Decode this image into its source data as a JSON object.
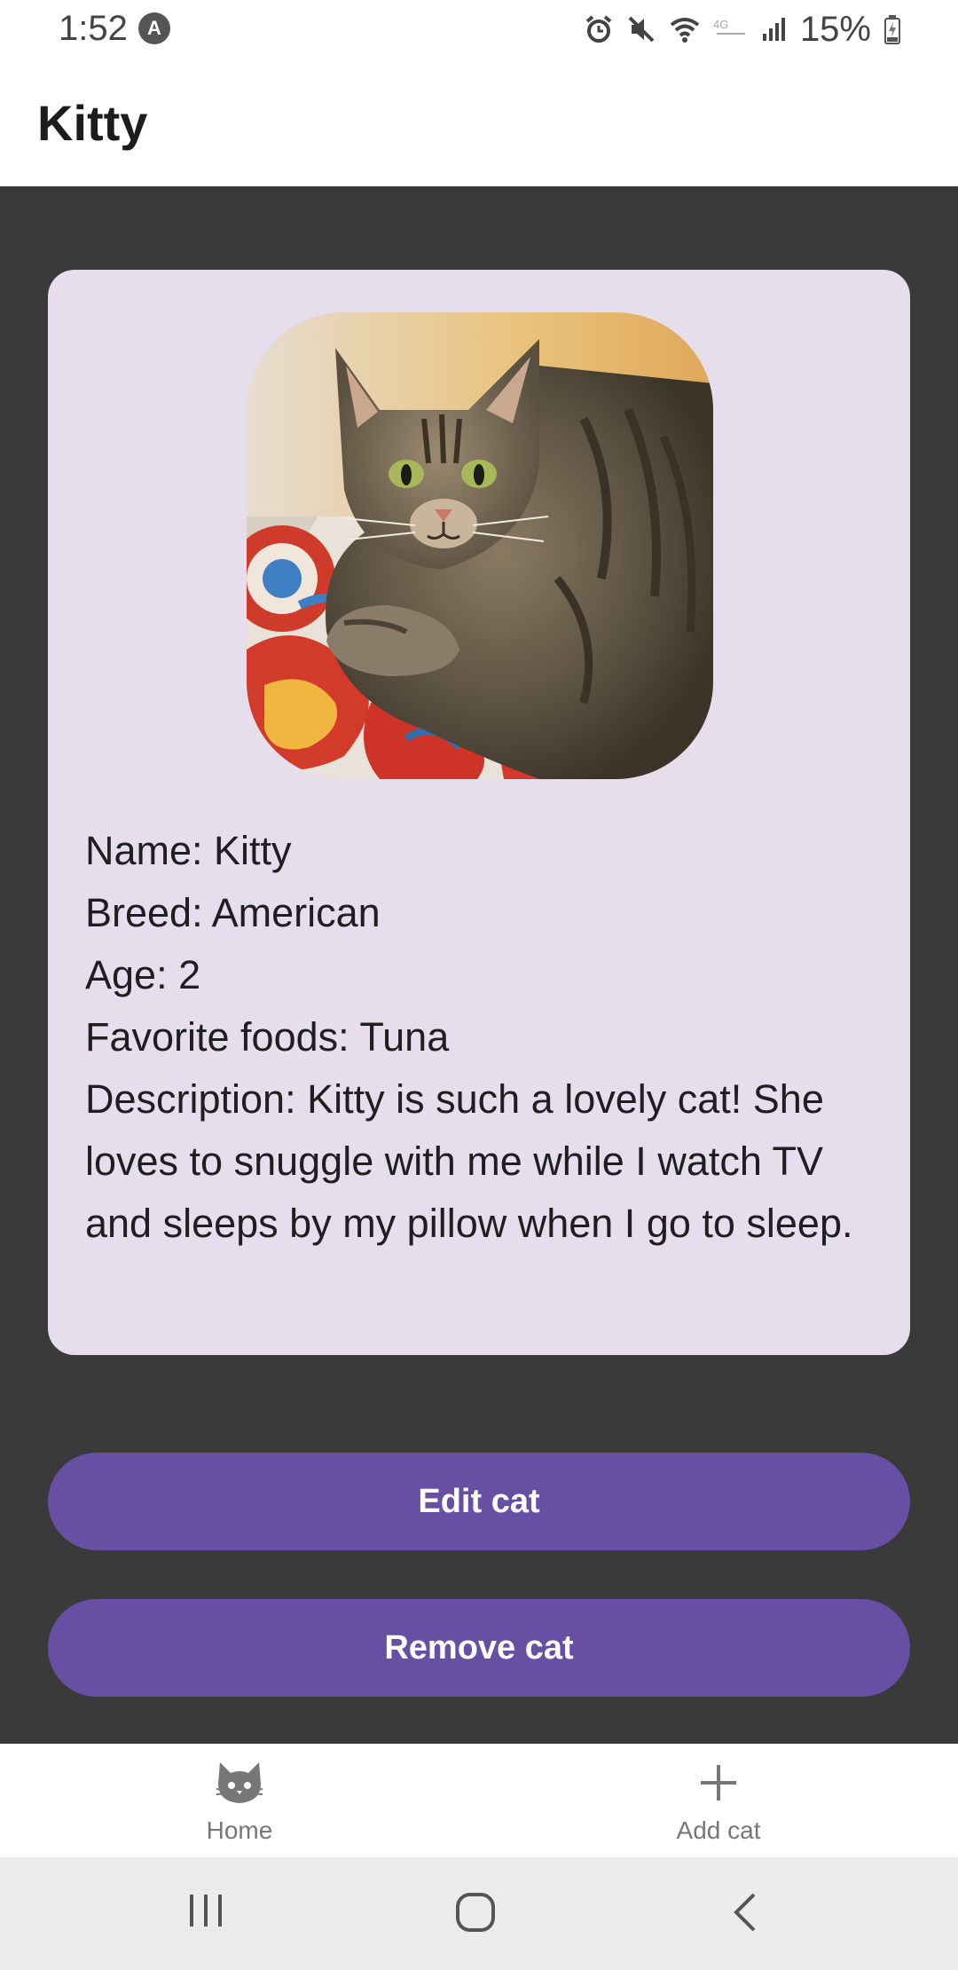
{
  "status_bar": {
    "time": "1:52",
    "app_icon": "A",
    "battery_text": "15%",
    "icons": [
      "alarm-icon",
      "mute-icon",
      "wifi-icon",
      "lte-icon",
      "signal-icon",
      "battery-icon"
    ]
  },
  "app_bar": {
    "title": "Kitty"
  },
  "cat": {
    "photo_icon": "cat-photo",
    "lines": {
      "name": "Name: Kitty",
      "breed": "Breed: American",
      "age": "Age: 2",
      "foods": "Favorite foods: Tuna",
      "description": "Description: Kitty is such a lovely cat! She loves to snuggle with me while I watch TV and sleeps by my pillow when I go to sleep."
    }
  },
  "actions": {
    "edit_label": "Edit cat",
    "remove_label": "Remove cat"
  },
  "bottom_nav": {
    "home_label": "Home",
    "home_icon": "cat-face-icon",
    "add_label": "Add cat",
    "add_icon": "plus-icon"
  },
  "system_nav": {
    "icons": [
      "recents-icon",
      "home-icon",
      "back-icon"
    ]
  },
  "colors": {
    "accent": "#6750a4",
    "card": "#e6dded",
    "background": "#3a3a3a"
  }
}
